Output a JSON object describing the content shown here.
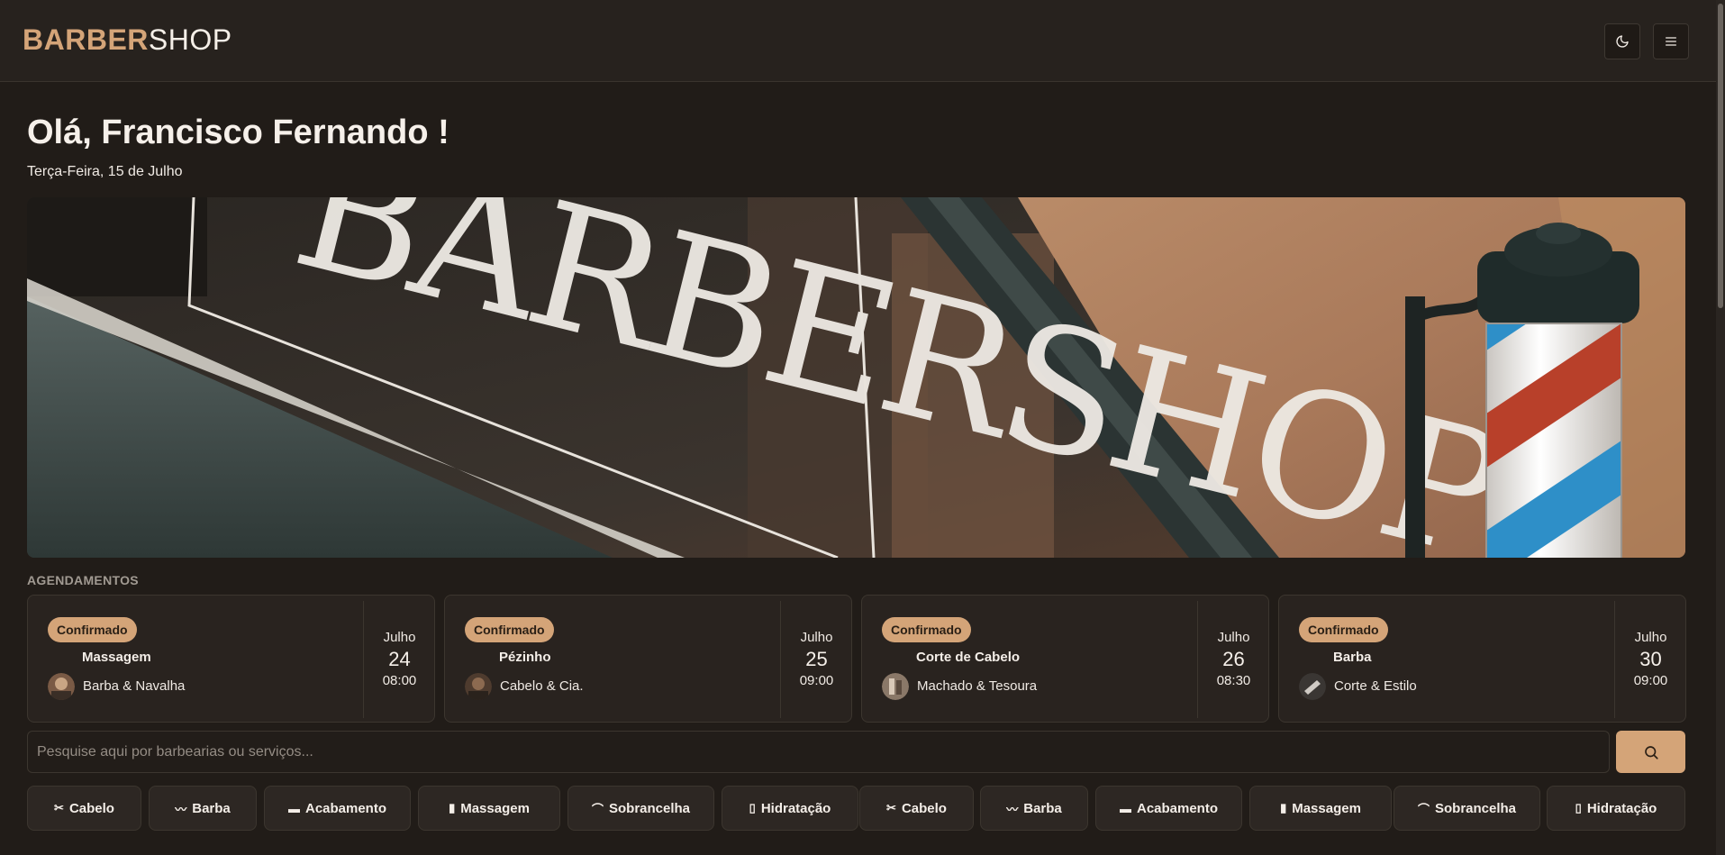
{
  "header": {
    "logo_bold": "BARBER",
    "logo_light": "SHOP",
    "theme_icon": "moon-icon",
    "menu_icon": "menu-icon"
  },
  "greeting": "Olá, Francisco Fernando !",
  "date": "Terça-Feira, 15 de Julho",
  "banner": {
    "alt_text": "BARBERSHOP"
  },
  "bookings_title": "AGENDAMENTOS",
  "bookings": [
    {
      "status": "Confirmado",
      "service": "Massagem",
      "shop": "Barba & Navalha",
      "month": "Julho",
      "day": "24",
      "time": "08:00"
    },
    {
      "status": "Confirmado",
      "service": "Pézinho",
      "shop": "Cabelo & Cia.",
      "month": "Julho",
      "day": "25",
      "time": "09:00"
    },
    {
      "status": "Confirmado",
      "service": "Corte de Cabelo",
      "shop": "Machado & Tesoura",
      "month": "Julho",
      "day": "26",
      "time": "08:30"
    },
    {
      "status": "Confirmado",
      "service": "Barba",
      "shop": "Corte & Estilo",
      "month": "Julho",
      "day": "30",
      "time": "09:00"
    }
  ],
  "search": {
    "placeholder": "Pesquise aqui por barbearias ou serviços...",
    "button_icon": "search-icon"
  },
  "categories": [
    {
      "label": "Cabelo",
      "icon": "scissors-icon"
    },
    {
      "label": "Barba",
      "icon": "mustache-icon"
    },
    {
      "label": "Acabamento",
      "icon": "razor-icon"
    },
    {
      "label": "Massagem",
      "icon": "towel-icon"
    },
    {
      "label": "Sobrancelha",
      "icon": "eyebrow-icon"
    },
    {
      "label": "Hidratação",
      "icon": "bottle-icon"
    },
    {
      "label": "Cabelo",
      "icon": "scissors-icon"
    },
    {
      "label": "Barba",
      "icon": "mustache-icon"
    },
    {
      "label": "Acabamento",
      "icon": "razor-icon"
    },
    {
      "label": "Massagem",
      "icon": "towel-icon"
    },
    {
      "label": "Sobrancelha",
      "icon": "eyebrow-icon"
    },
    {
      "label": "Hidratação",
      "icon": "bottle-icon"
    }
  ],
  "colors": {
    "accent": "#d4a478",
    "background": "#211c18",
    "card": "#29231f"
  }
}
